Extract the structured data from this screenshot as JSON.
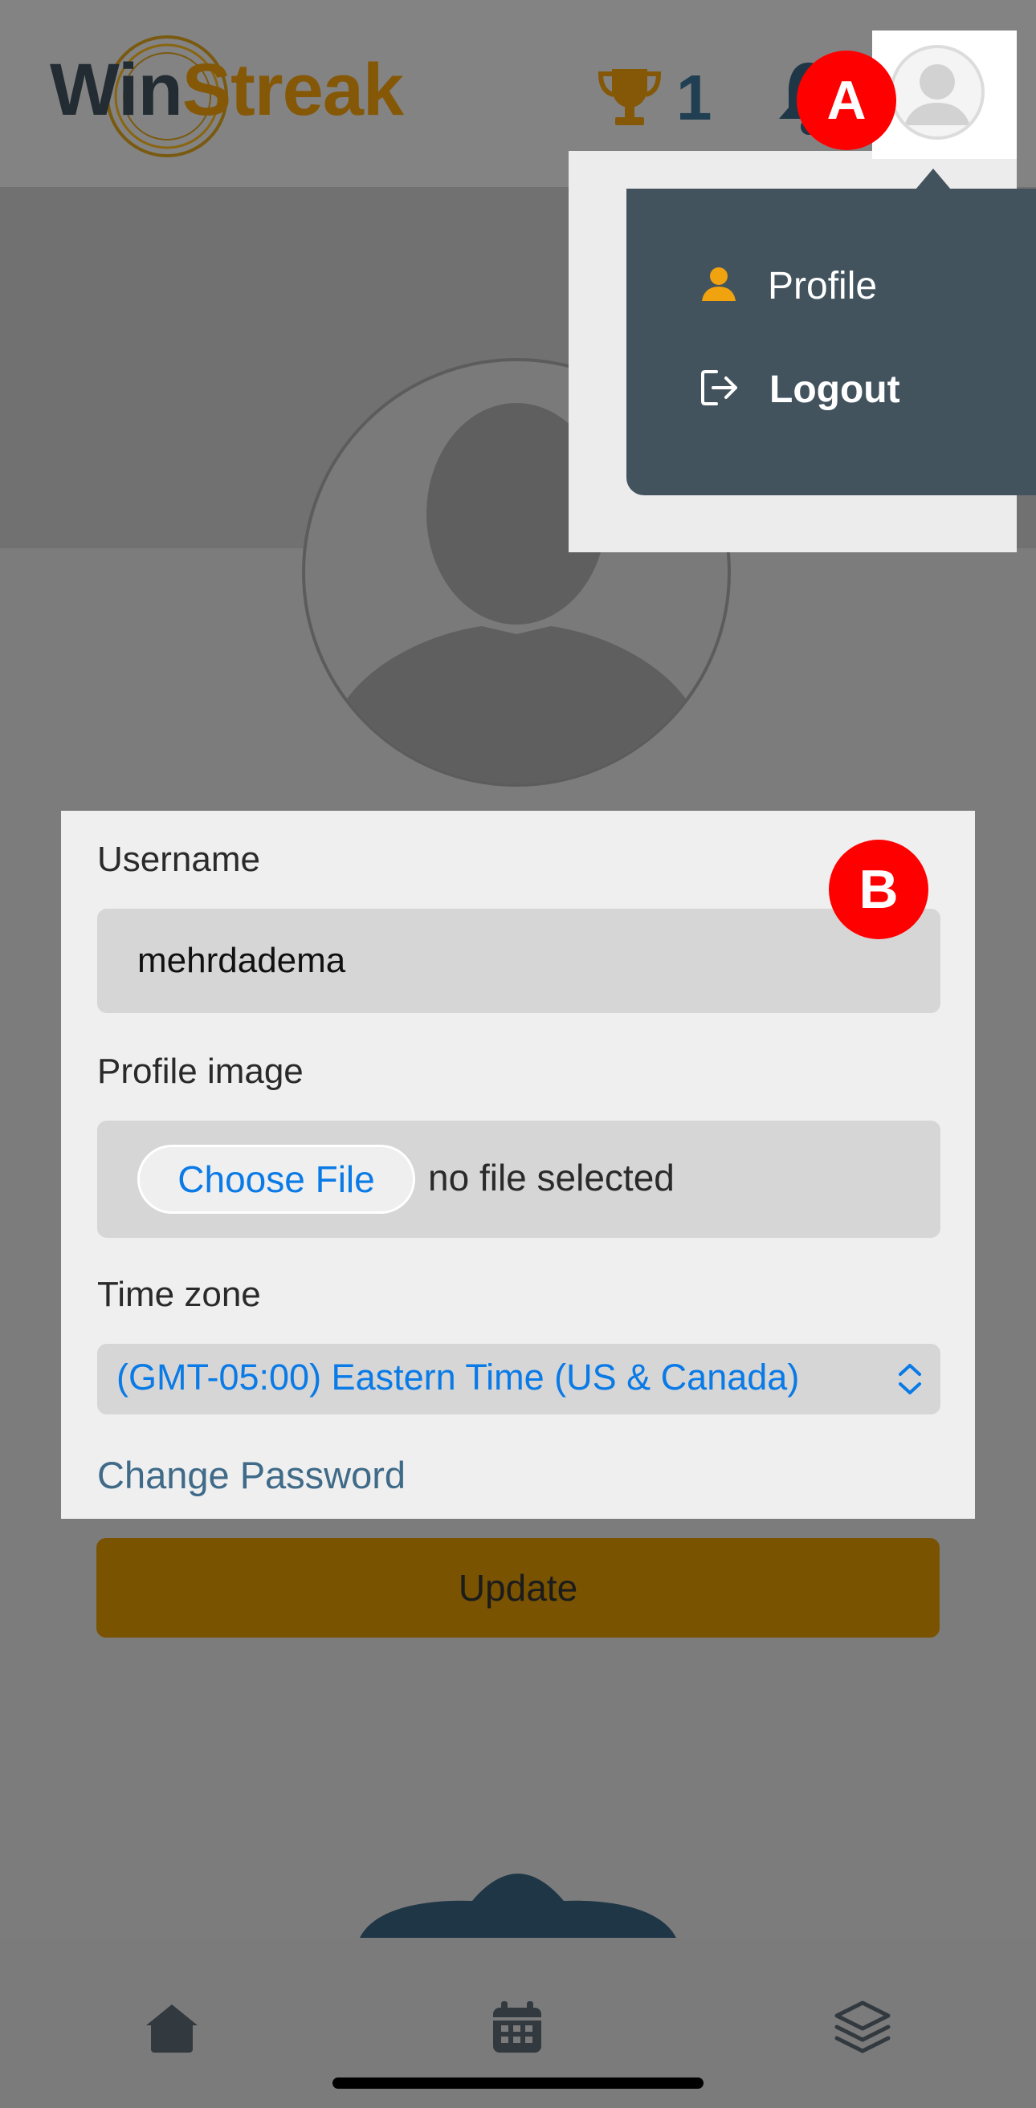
{
  "header": {
    "logo_part1": "Win",
    "logo_part2": "Streak",
    "trophy_count": "1"
  },
  "dropdown": {
    "items": [
      {
        "label": "Profile",
        "icon": "person-icon"
      },
      {
        "label": "Logout",
        "icon": "logout-icon"
      }
    ]
  },
  "markers": {
    "a": "A",
    "b": "B"
  },
  "form": {
    "username_label": "Username",
    "username_value": "mehrdadema",
    "profile_image_label": "Profile image",
    "choose_file_label": "Choose File",
    "file_status": "no file selected",
    "timezone_label": "Time zone",
    "timezone_value": "(GMT-05:00) Eastern Time (US & Canada)",
    "change_password_label": "Change Password"
  },
  "update_button_label": "Update",
  "bottom_nav": {
    "items": [
      {
        "icon": "home-icon"
      },
      {
        "icon": "calendar-icon"
      },
      {
        "icon": "layers-icon"
      }
    ]
  },
  "colors": {
    "accent_gold": "#845807",
    "navy": "#213f52",
    "menu_bg": "#42535e",
    "link_blue": "#0a7ae6",
    "marker_red": "#ff0000"
  }
}
